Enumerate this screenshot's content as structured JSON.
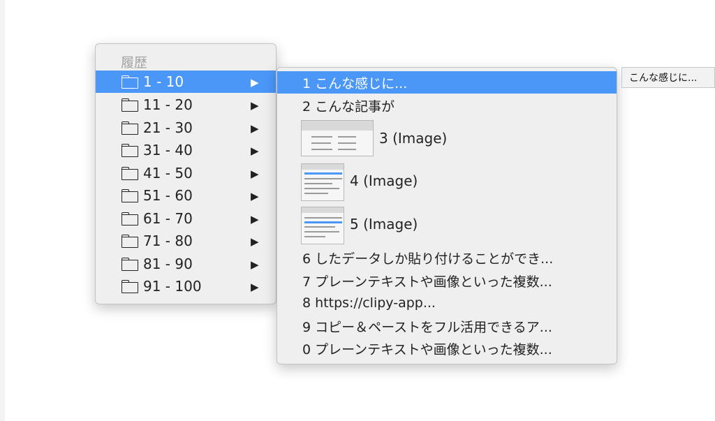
{
  "history_menu": {
    "header": "履歴",
    "items": [
      {
        "label": "1 - 10",
        "arrow": "▶"
      },
      {
        "label": "11 - 20",
        "arrow": "▶"
      },
      {
        "label": "21 - 30",
        "arrow": "▶"
      },
      {
        "label": "31 - 40",
        "arrow": "▶"
      },
      {
        "label": "41 - 50",
        "arrow": "▶"
      },
      {
        "label": "51 - 60",
        "arrow": "▶"
      },
      {
        "label": "61 - 70",
        "arrow": "▶"
      },
      {
        "label": "71 - 80",
        "arrow": "▶"
      },
      {
        "label": "81 - 90",
        "arrow": "▶"
      },
      {
        "label": "91 - 100",
        "arrow": "▶"
      }
    ],
    "selected_index": 0,
    "item_icon": "folder-icon"
  },
  "submenu": {
    "items": [
      {
        "label": "1 こんな感じに..."
      },
      {
        "label": "2 こんな記事が"
      },
      {
        "label": "3 (Image)"
      },
      {
        "label": "4 (Image)"
      },
      {
        "label": "5 (Image)"
      },
      {
        "label": "6 したデータしか貼り付けることができ..."
      },
      {
        "label": "7 プレーンテキストや画像といった複数..."
      },
      {
        "label": "8 https://clipy-app..."
      },
      {
        "label": "9 コピー＆ペーストをフル活用できるア..."
      },
      {
        "label": "0 プレーンテキストや画像といった複数..."
      }
    ]
  },
  "tooltip": {
    "text": "こんな感じに..."
  },
  "colors": {
    "highlight": "#4a97f8",
    "menu_bg": "#efefef"
  }
}
